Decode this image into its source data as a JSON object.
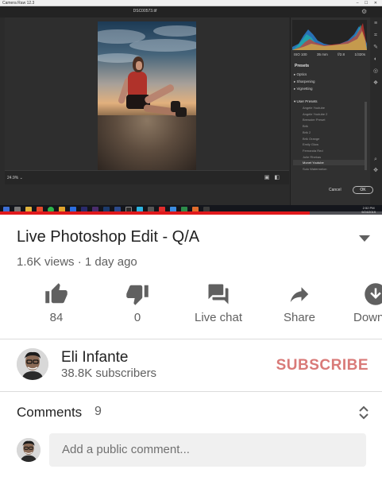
{
  "camera_raw": {
    "window_title": "Camera Raw 12.3",
    "window_controls": "–  ☐  ✕",
    "filename": "DSC00573.tif",
    "zoom_level": "24.9%",
    "zoom_caret": "⌄",
    "camera_info": [
      "ISO 100",
      "35 mm",
      "f/2.8",
      "1/320s"
    ],
    "panel_title": "Presets",
    "sections": [
      "Optics",
      "Sharpening",
      "Vignetting"
    ],
    "user_presets_label": "User Presets",
    "presets": [
      "Angele Youtube",
      "Angele Youtube 2",
      "Brewster Preset",
      "Brik",
      "Brik 2",
      "Brik Orange",
      "Emily Glow",
      "Fernanda Red",
      "Julie Rhebas",
      "Monet Youtube",
      "Sulo Watermelon"
    ],
    "selected_preset_index": 9,
    "cancel_label": "Cancel",
    "ok_label": "OK",
    "clock_time": "2:52 PM",
    "clock_date": "9/24/2019"
  },
  "video": {
    "progress": 0.81
  },
  "details": {
    "title": "Live Photoshop Edit - Q/A",
    "meta": "1.6K views · 1 day ago"
  },
  "actions": [
    {
      "name": "like",
      "label": "84",
      "icon": "thumbs-up-icon"
    },
    {
      "name": "dislike",
      "label": "0",
      "icon": "thumbs-down-icon"
    },
    {
      "name": "live-chat",
      "label": "Live chat",
      "icon": "chat-icon"
    },
    {
      "name": "share",
      "label": "Share",
      "icon": "share-icon"
    },
    {
      "name": "download",
      "label": "Down",
      "icon": "download-icon"
    }
  ],
  "channel": {
    "name": "Eli Infante",
    "subscribers": "38.8K subscribers",
    "subscribe_label": "SUBSCRIBE"
  },
  "comments": {
    "title": "Comments",
    "count": "9",
    "placeholder": "Add a public comment..."
  },
  "colors": {
    "accent_red": "#e0191c",
    "subscribe": "#d97a78",
    "text_primary": "#222222",
    "text_secondary": "#606060"
  }
}
